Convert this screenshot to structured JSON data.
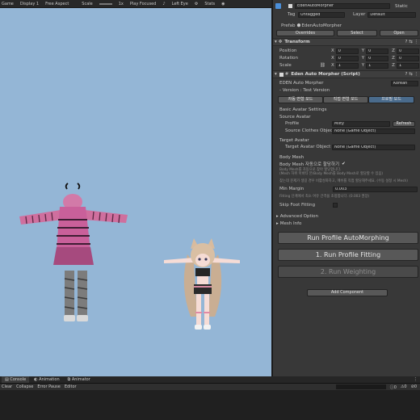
{
  "game_toolbar": {
    "tab": "Game",
    "display": "Display 1",
    "aspect": "Free Aspect",
    "scale_label": "Scale",
    "scale_value": "1x",
    "play_mode": "Play Focused",
    "eye": "Left Eye",
    "stats": "Stats"
  },
  "inspector": {
    "object_name": "EdenAutoMorpher",
    "static_label": "Static",
    "tag_label": "Tag",
    "tag_value": "Untagged",
    "layer_label": "Layer",
    "layer_value": "Default",
    "prefab_label": "Prefab",
    "prefab_value": "EdenAutoMorpher",
    "overrides": "Overrides",
    "select": "Select",
    "open": "Open",
    "transform": {
      "title": "Transform",
      "position_label": "Position",
      "rotation_label": "Rotation",
      "scale_label": "Scale",
      "position": [
        "0",
        "0",
        "0"
      ],
      "rotation": [
        "0",
        "0",
        "0"
      ],
      "scale": [
        "1",
        "1",
        "1"
      ]
    },
    "script": {
      "title": "Eden Auto Morpher (Script)",
      "name": "EDEN Auto Morpher",
      "version": "- Version : Test Version",
      "language": "Korean",
      "mode_tabs": [
        "자동 변형 모드",
        "직접 변형 모드",
        "프로필 모드"
      ],
      "basic_settings": "Basic Avatar Settings",
      "source_avatar": "Source Avatar",
      "profile_label": "Profile",
      "profile_value": "Milty",
      "refresh": "Refresh",
      "source_clothes_label": "Source Clothes Object",
      "source_clothes_value": "None (Game Object)",
      "target_avatar": "Target Avatar",
      "target_avatar_label": "Target Avatar Object",
      "target_avatar_value": "None (Game Object)",
      "body_mesh": "Body Mesh",
      "body_mesh_auto": "Body Mesh 자동으로 할당하기",
      "body_mesh_help1": "Body Mesh를 자동으로 찾아 할당합니다.",
      "body_mesh_help2": "(Mesh 하위 아바타 본/Body Mesh를 Body Mesh로 할당할 수 있음)",
      "body_mesh_help3": "찾는데 문제가 생길 경우 비활성화하고, 메쉬를 직접 할당해주세요. (수동 설정 시 Mesh)",
      "min_margin_label": "Min Margin",
      "min_margin_value": "0.003",
      "min_margin_help": "Fitting 단계에서 최소 여유 간격을 조정합니다. (0.003 권장)",
      "skip_foot_label": "Skip Foot Fitting",
      "advanced": "Advanced Option",
      "mesh_info": "Mesh Info",
      "run_profile": "Run Profile AutoMorphing",
      "run_fitting": "1. Run Profile Fitting",
      "run_weighting": "2. Run Weighting",
      "add_component": "Add Component"
    }
  },
  "console": {
    "tabs": [
      "Console",
      "Animation",
      "Animator"
    ],
    "tools": [
      "Clear",
      "Collapse",
      "Error Pause",
      "Editor"
    ],
    "counts": [
      "0",
      "0",
      "0"
    ]
  },
  "colors": {
    "game_bg": "#94b6d6",
    "panel_bg": "#383838",
    "active_tab": "#4a6b8c"
  }
}
